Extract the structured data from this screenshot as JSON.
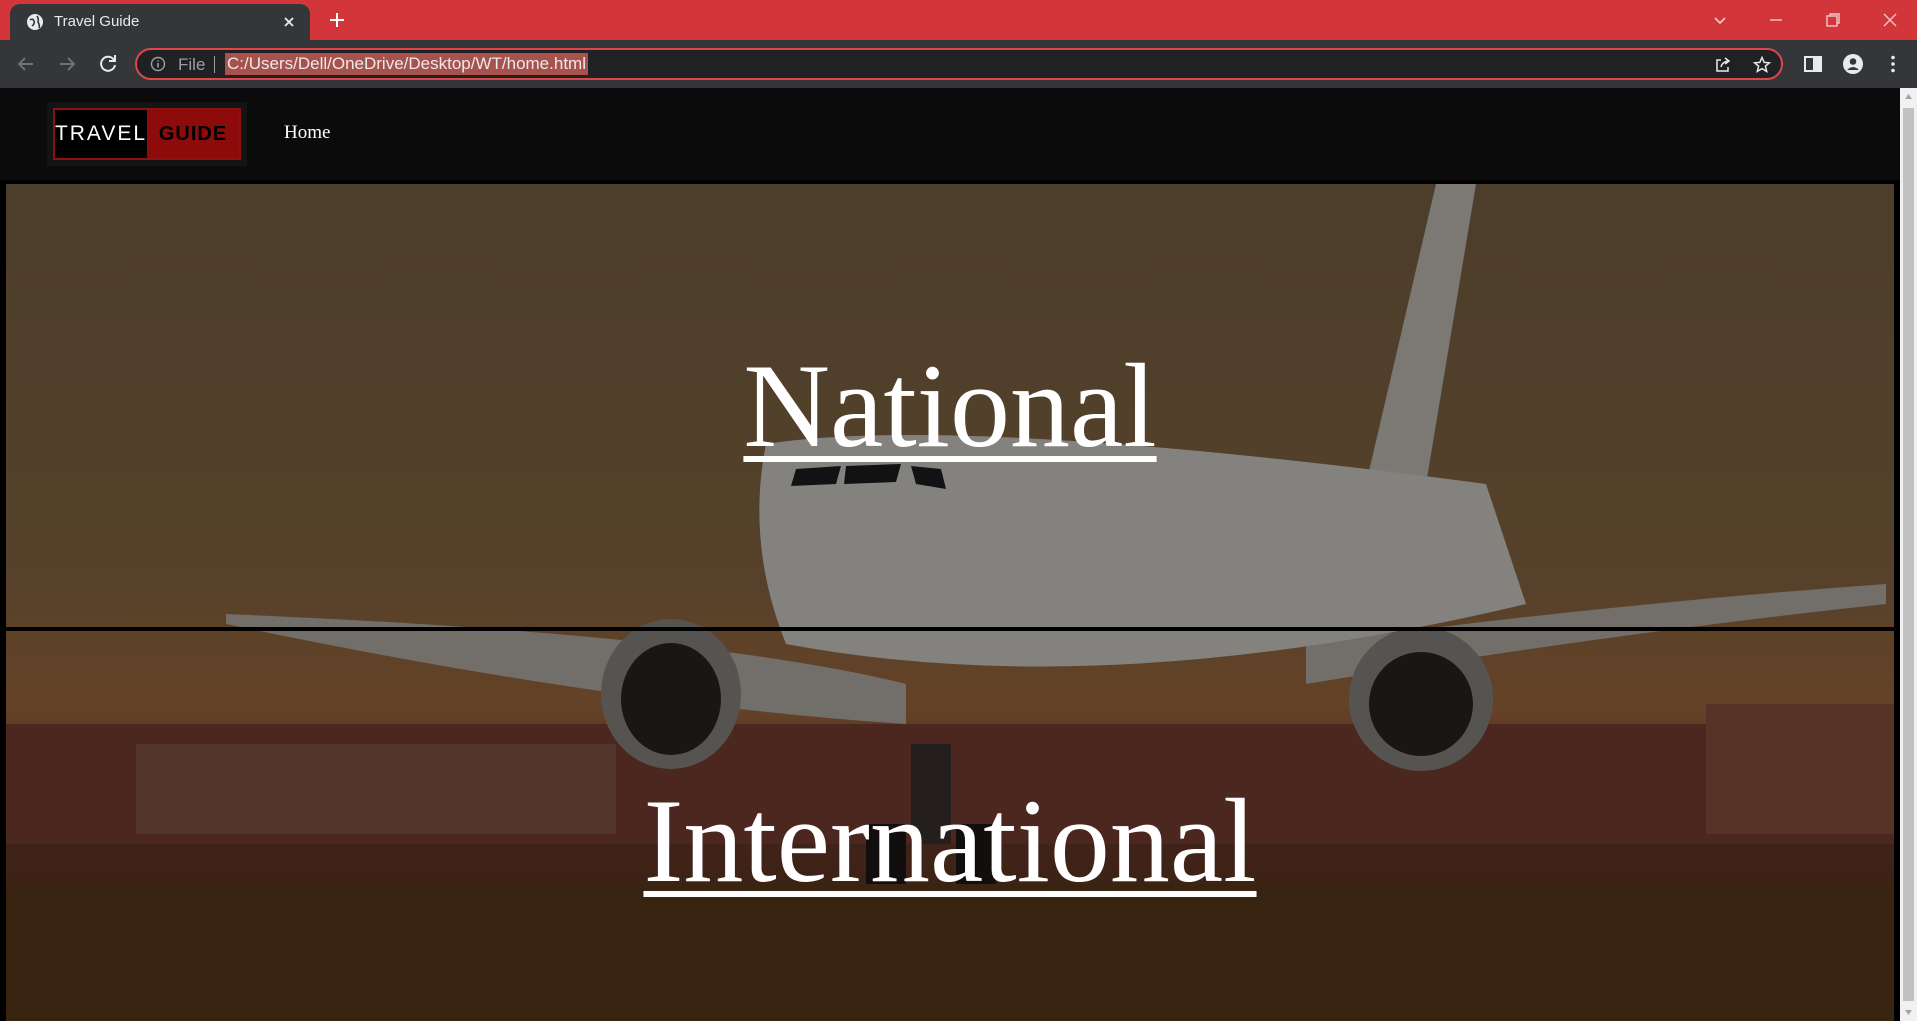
{
  "browser": {
    "tab_title": "Travel Guide",
    "scheme_label": "File",
    "url": "C:/Users/Dell/OneDrive/Desktop/WT/home.html"
  },
  "site": {
    "logo": {
      "word1": "TRAVEL",
      "word2": "GUIDE"
    },
    "nav": {
      "home": "Home"
    }
  },
  "sections": [
    {
      "label": "National"
    },
    {
      "label": "International"
    }
  ],
  "colors": {
    "tabstrip": "#d2363b",
    "toolbar": "#35363a",
    "logo_red": "#8e0b0b",
    "navbar": "#0b0b0b"
  }
}
